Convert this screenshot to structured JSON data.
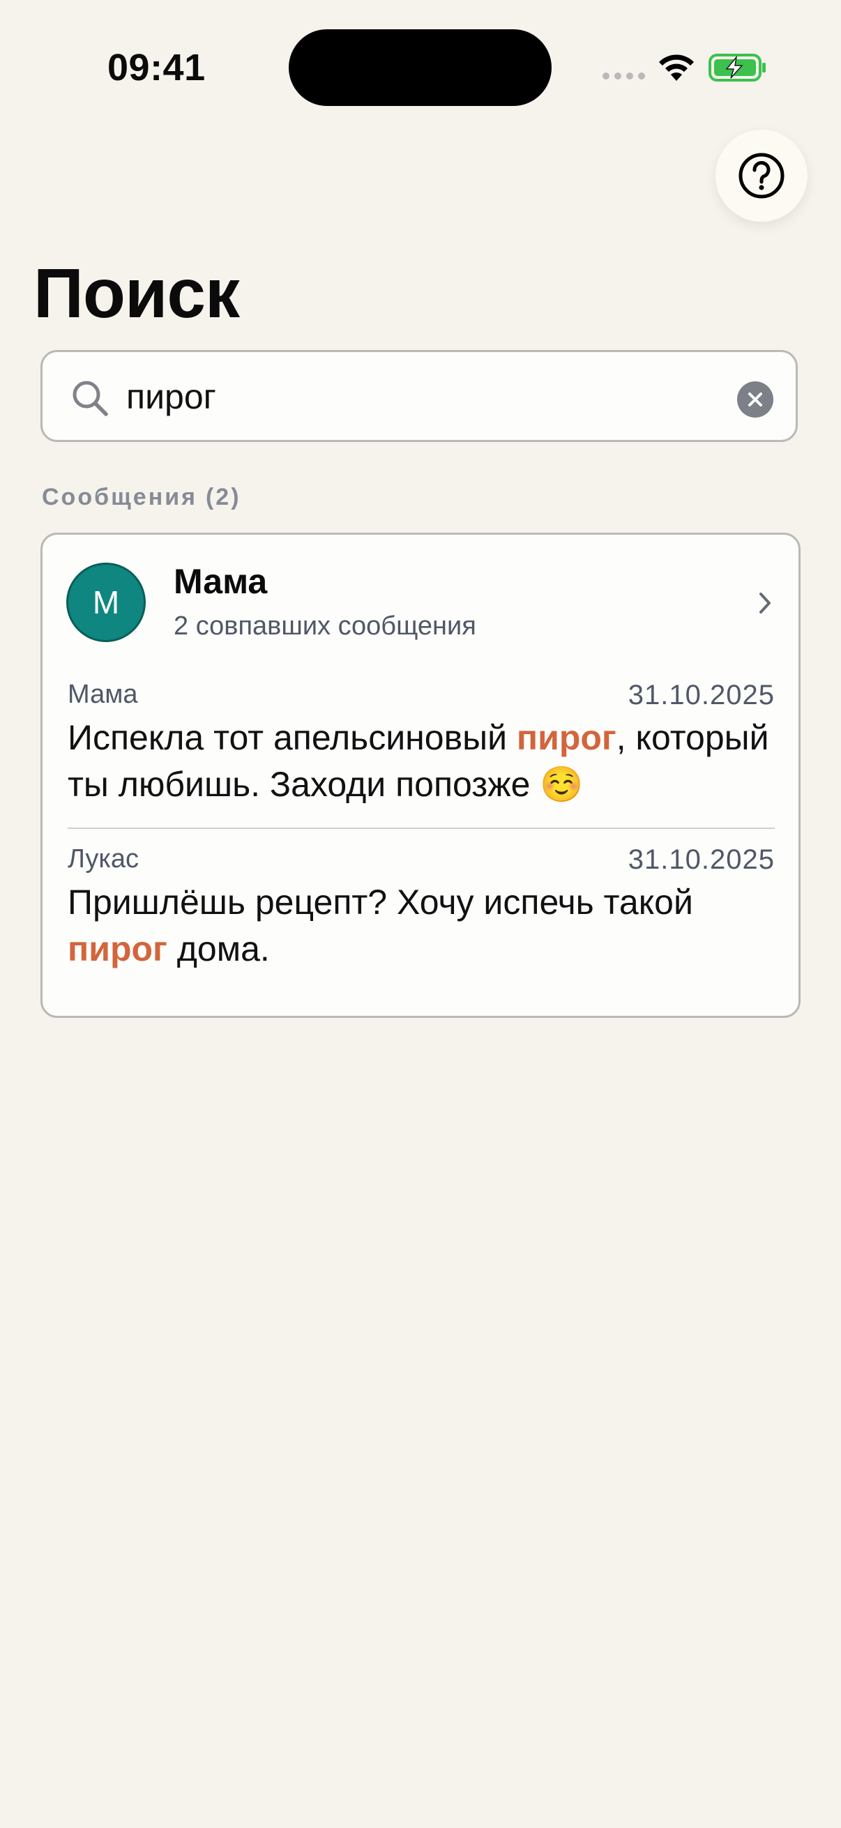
{
  "status_bar": {
    "time": "09:41"
  },
  "help": {
    "icon": "question-circle-icon"
  },
  "page_title": "Поиск",
  "search": {
    "value": "пирог",
    "icon": "search-icon",
    "clear_icon": "clear-icon"
  },
  "section": {
    "title": "Сообщения",
    "count": "(2)"
  },
  "result": {
    "avatar_initial": "М",
    "avatar_color": "#0f8680",
    "contact_name": "Мама",
    "match_count": "2 совпавших сообщения",
    "messages": [
      {
        "sender": "Мама",
        "date": "31.10.2025",
        "text_before": "Испекла тот апельсиновый ",
        "highlight": "пирог",
        "text_after": ", который ты любишь. Заходи попозже ☺️"
      },
      {
        "sender": "Лукас",
        "date": "31.10.2025",
        "text_before": "Пришлёшь рецепт? Хочу испечь такой ",
        "highlight": "пирог",
        "text_after": " дома."
      }
    ]
  },
  "colors": {
    "background": "#f5f3ec",
    "highlight": "#d2653c",
    "secondary_text": "#505866",
    "section_header": "#868b95"
  }
}
